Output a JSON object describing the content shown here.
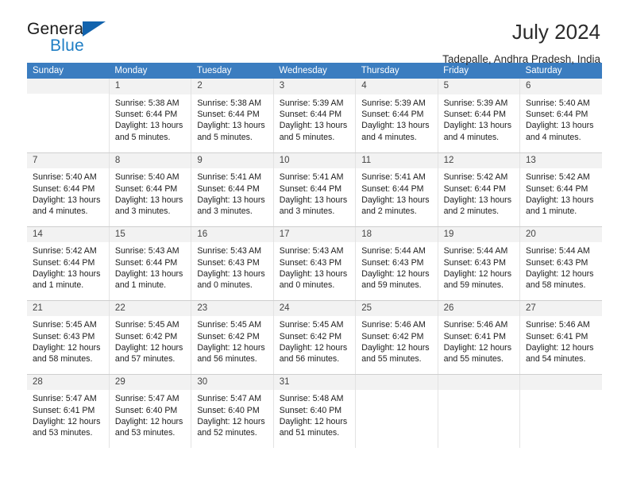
{
  "brand": {
    "name_part1": "General",
    "name_part2": "Blue",
    "accent_color": "#1f7ec4",
    "triangle_color": "#1263ad"
  },
  "header": {
    "title": "July 2024",
    "subtitle": "Tadepalle, Andhra Pradesh, India"
  },
  "calendar": {
    "header_background": "#3b7dc0",
    "daynum_background": "#f2f2f2",
    "weekdays": [
      "Sunday",
      "Monday",
      "Tuesday",
      "Wednesday",
      "Thursday",
      "Friday",
      "Saturday"
    ],
    "weeks": [
      [
        {
          "day": "",
          "sunrise": "",
          "sunset": "",
          "daylight": "",
          "empty": true
        },
        {
          "day": "1",
          "sunrise": "Sunrise: 5:38 AM",
          "sunset": "Sunset: 6:44 PM",
          "daylight": "Daylight: 13 hours and 5 minutes."
        },
        {
          "day": "2",
          "sunrise": "Sunrise: 5:38 AM",
          "sunset": "Sunset: 6:44 PM",
          "daylight": "Daylight: 13 hours and 5 minutes."
        },
        {
          "day": "3",
          "sunrise": "Sunrise: 5:39 AM",
          "sunset": "Sunset: 6:44 PM",
          "daylight": "Daylight: 13 hours and 5 minutes."
        },
        {
          "day": "4",
          "sunrise": "Sunrise: 5:39 AM",
          "sunset": "Sunset: 6:44 PM",
          "daylight": "Daylight: 13 hours and 4 minutes."
        },
        {
          "day": "5",
          "sunrise": "Sunrise: 5:39 AM",
          "sunset": "Sunset: 6:44 PM",
          "daylight": "Daylight: 13 hours and 4 minutes."
        },
        {
          "day": "6",
          "sunrise": "Sunrise: 5:40 AM",
          "sunset": "Sunset: 6:44 PM",
          "daylight": "Daylight: 13 hours and 4 minutes."
        }
      ],
      [
        {
          "day": "7",
          "sunrise": "Sunrise: 5:40 AM",
          "sunset": "Sunset: 6:44 PM",
          "daylight": "Daylight: 13 hours and 4 minutes."
        },
        {
          "day": "8",
          "sunrise": "Sunrise: 5:40 AM",
          "sunset": "Sunset: 6:44 PM",
          "daylight": "Daylight: 13 hours and 3 minutes."
        },
        {
          "day": "9",
          "sunrise": "Sunrise: 5:41 AM",
          "sunset": "Sunset: 6:44 PM",
          "daylight": "Daylight: 13 hours and 3 minutes."
        },
        {
          "day": "10",
          "sunrise": "Sunrise: 5:41 AM",
          "sunset": "Sunset: 6:44 PM",
          "daylight": "Daylight: 13 hours and 3 minutes."
        },
        {
          "day": "11",
          "sunrise": "Sunrise: 5:41 AM",
          "sunset": "Sunset: 6:44 PM",
          "daylight": "Daylight: 13 hours and 2 minutes."
        },
        {
          "day": "12",
          "sunrise": "Sunrise: 5:42 AM",
          "sunset": "Sunset: 6:44 PM",
          "daylight": "Daylight: 13 hours and 2 minutes."
        },
        {
          "day": "13",
          "sunrise": "Sunrise: 5:42 AM",
          "sunset": "Sunset: 6:44 PM",
          "daylight": "Daylight: 13 hours and 1 minute."
        }
      ],
      [
        {
          "day": "14",
          "sunrise": "Sunrise: 5:42 AM",
          "sunset": "Sunset: 6:44 PM",
          "daylight": "Daylight: 13 hours and 1 minute."
        },
        {
          "day": "15",
          "sunrise": "Sunrise: 5:43 AM",
          "sunset": "Sunset: 6:44 PM",
          "daylight": "Daylight: 13 hours and 1 minute."
        },
        {
          "day": "16",
          "sunrise": "Sunrise: 5:43 AM",
          "sunset": "Sunset: 6:43 PM",
          "daylight": "Daylight: 13 hours and 0 minutes."
        },
        {
          "day": "17",
          "sunrise": "Sunrise: 5:43 AM",
          "sunset": "Sunset: 6:43 PM",
          "daylight": "Daylight: 13 hours and 0 minutes."
        },
        {
          "day": "18",
          "sunrise": "Sunrise: 5:44 AM",
          "sunset": "Sunset: 6:43 PM",
          "daylight": "Daylight: 12 hours and 59 minutes."
        },
        {
          "day": "19",
          "sunrise": "Sunrise: 5:44 AM",
          "sunset": "Sunset: 6:43 PM",
          "daylight": "Daylight: 12 hours and 59 minutes."
        },
        {
          "day": "20",
          "sunrise": "Sunrise: 5:44 AM",
          "sunset": "Sunset: 6:43 PM",
          "daylight": "Daylight: 12 hours and 58 minutes."
        }
      ],
      [
        {
          "day": "21",
          "sunrise": "Sunrise: 5:45 AM",
          "sunset": "Sunset: 6:43 PM",
          "daylight": "Daylight: 12 hours and 58 minutes."
        },
        {
          "day": "22",
          "sunrise": "Sunrise: 5:45 AM",
          "sunset": "Sunset: 6:42 PM",
          "daylight": "Daylight: 12 hours and 57 minutes."
        },
        {
          "day": "23",
          "sunrise": "Sunrise: 5:45 AM",
          "sunset": "Sunset: 6:42 PM",
          "daylight": "Daylight: 12 hours and 56 minutes."
        },
        {
          "day": "24",
          "sunrise": "Sunrise: 5:45 AM",
          "sunset": "Sunset: 6:42 PM",
          "daylight": "Daylight: 12 hours and 56 minutes."
        },
        {
          "day": "25",
          "sunrise": "Sunrise: 5:46 AM",
          "sunset": "Sunset: 6:42 PM",
          "daylight": "Daylight: 12 hours and 55 minutes."
        },
        {
          "day": "26",
          "sunrise": "Sunrise: 5:46 AM",
          "sunset": "Sunset: 6:41 PM",
          "daylight": "Daylight: 12 hours and 55 minutes."
        },
        {
          "day": "27",
          "sunrise": "Sunrise: 5:46 AM",
          "sunset": "Sunset: 6:41 PM",
          "daylight": "Daylight: 12 hours and 54 minutes."
        }
      ],
      [
        {
          "day": "28",
          "sunrise": "Sunrise: 5:47 AM",
          "sunset": "Sunset: 6:41 PM",
          "daylight": "Daylight: 12 hours and 53 minutes."
        },
        {
          "day": "29",
          "sunrise": "Sunrise: 5:47 AM",
          "sunset": "Sunset: 6:40 PM",
          "daylight": "Daylight: 12 hours and 53 minutes."
        },
        {
          "day": "30",
          "sunrise": "Sunrise: 5:47 AM",
          "sunset": "Sunset: 6:40 PM",
          "daylight": "Daylight: 12 hours and 52 minutes."
        },
        {
          "day": "31",
          "sunrise": "Sunrise: 5:48 AM",
          "sunset": "Sunset: 6:40 PM",
          "daylight": "Daylight: 12 hours and 51 minutes."
        },
        {
          "day": "",
          "sunrise": "",
          "sunset": "",
          "daylight": "",
          "empty": true
        },
        {
          "day": "",
          "sunrise": "",
          "sunset": "",
          "daylight": "",
          "empty": true
        },
        {
          "day": "",
          "sunrise": "",
          "sunset": "",
          "daylight": "",
          "empty": true
        }
      ]
    ]
  }
}
